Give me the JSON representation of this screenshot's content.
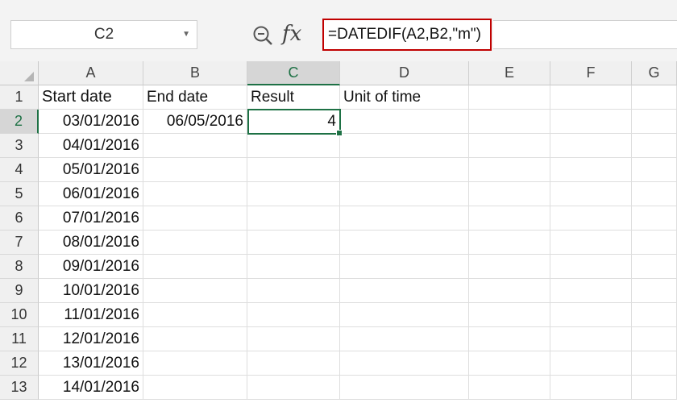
{
  "name_box": {
    "value": "C2"
  },
  "formula_bar": {
    "formula": "=DATEDIF(A2,B2,\"m\")",
    "fx_label": "fx"
  },
  "columns": [
    "A",
    "B",
    "C",
    "D",
    "E",
    "F",
    "G"
  ],
  "rows": [
    {
      "num": "1",
      "cells": [
        "Start date",
        "End date",
        "Result",
        "Unit of time",
        "",
        "",
        ""
      ]
    },
    {
      "num": "2",
      "cells": [
        "03/01/2016",
        "06/05/2016",
        "4",
        "",
        "",
        "",
        ""
      ]
    },
    {
      "num": "3",
      "cells": [
        "04/01/2016",
        "",
        "",
        "",
        "",
        "",
        ""
      ]
    },
    {
      "num": "4",
      "cells": [
        "05/01/2016",
        "",
        "",
        "",
        "",
        "",
        ""
      ]
    },
    {
      "num": "5",
      "cells": [
        "06/01/2016",
        "",
        "",
        "",
        "",
        "",
        ""
      ]
    },
    {
      "num": "6",
      "cells": [
        "07/01/2016",
        "",
        "",
        "",
        "",
        "",
        ""
      ]
    },
    {
      "num": "7",
      "cells": [
        "08/01/2016",
        "",
        "",
        "",
        "",
        "",
        ""
      ]
    },
    {
      "num": "8",
      "cells": [
        "09/01/2016",
        "",
        "",
        "",
        "",
        "",
        ""
      ]
    },
    {
      "num": "9",
      "cells": [
        "10/01/2016",
        "",
        "",
        "",
        "",
        "",
        ""
      ]
    },
    {
      "num": "10",
      "cells": [
        "11/01/2016",
        "",
        "",
        "",
        "",
        "",
        ""
      ]
    },
    {
      "num": "11",
      "cells": [
        "12/01/2016",
        "",
        "",
        "",
        "",
        "",
        ""
      ]
    },
    {
      "num": "12",
      "cells": [
        "13/01/2016",
        "",
        "",
        "",
        "",
        "",
        ""
      ]
    },
    {
      "num": "13",
      "cells": [
        "14/01/2016",
        "",
        "",
        "",
        "",
        "",
        ""
      ]
    }
  ],
  "active_cell": {
    "column": "C",
    "row": "2"
  },
  "colors": {
    "accent": "#1e7145",
    "formula_highlight": "#c00000"
  }
}
